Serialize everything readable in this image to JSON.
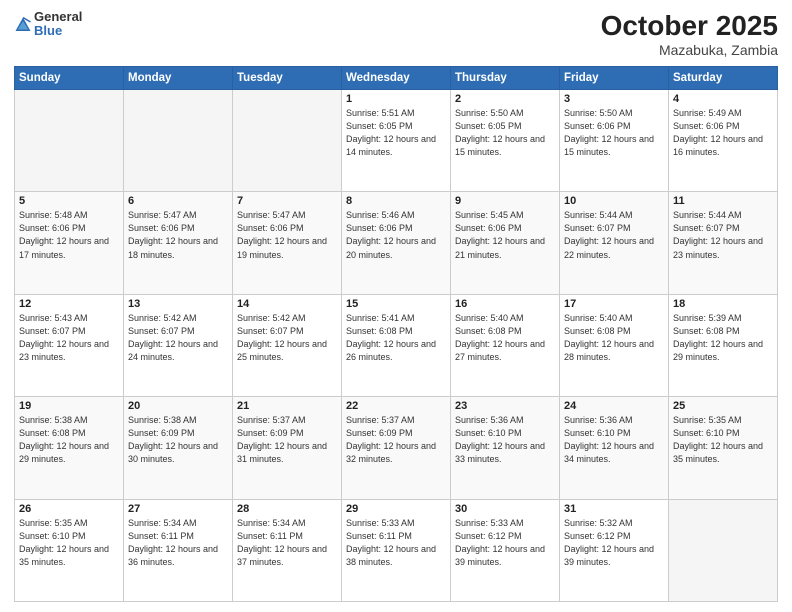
{
  "header": {
    "logo": {
      "general": "General",
      "blue": "Blue"
    },
    "title": "October 2025",
    "location": "Mazabuka, Zambia"
  },
  "calendar": {
    "days_of_week": [
      "Sunday",
      "Monday",
      "Tuesday",
      "Wednesday",
      "Thursday",
      "Friday",
      "Saturday"
    ],
    "weeks": [
      [
        {
          "day": "",
          "info": ""
        },
        {
          "day": "",
          "info": ""
        },
        {
          "day": "",
          "info": ""
        },
        {
          "day": "1",
          "info": "Sunrise: 5:51 AM\nSunset: 6:05 PM\nDaylight: 12 hours\nand 14 minutes."
        },
        {
          "day": "2",
          "info": "Sunrise: 5:50 AM\nSunset: 6:05 PM\nDaylight: 12 hours\nand 15 minutes."
        },
        {
          "day": "3",
          "info": "Sunrise: 5:50 AM\nSunset: 6:06 PM\nDaylight: 12 hours\nand 15 minutes."
        },
        {
          "day": "4",
          "info": "Sunrise: 5:49 AM\nSunset: 6:06 PM\nDaylight: 12 hours\nand 16 minutes."
        }
      ],
      [
        {
          "day": "5",
          "info": "Sunrise: 5:48 AM\nSunset: 6:06 PM\nDaylight: 12 hours\nand 17 minutes."
        },
        {
          "day": "6",
          "info": "Sunrise: 5:47 AM\nSunset: 6:06 PM\nDaylight: 12 hours\nand 18 minutes."
        },
        {
          "day": "7",
          "info": "Sunrise: 5:47 AM\nSunset: 6:06 PM\nDaylight: 12 hours\nand 19 minutes."
        },
        {
          "day": "8",
          "info": "Sunrise: 5:46 AM\nSunset: 6:06 PM\nDaylight: 12 hours\nand 20 minutes."
        },
        {
          "day": "9",
          "info": "Sunrise: 5:45 AM\nSunset: 6:06 PM\nDaylight: 12 hours\nand 21 minutes."
        },
        {
          "day": "10",
          "info": "Sunrise: 5:44 AM\nSunset: 6:07 PM\nDaylight: 12 hours\nand 22 minutes."
        },
        {
          "day": "11",
          "info": "Sunrise: 5:44 AM\nSunset: 6:07 PM\nDaylight: 12 hours\nand 23 minutes."
        }
      ],
      [
        {
          "day": "12",
          "info": "Sunrise: 5:43 AM\nSunset: 6:07 PM\nDaylight: 12 hours\nand 23 minutes."
        },
        {
          "day": "13",
          "info": "Sunrise: 5:42 AM\nSunset: 6:07 PM\nDaylight: 12 hours\nand 24 minutes."
        },
        {
          "day": "14",
          "info": "Sunrise: 5:42 AM\nSunset: 6:07 PM\nDaylight: 12 hours\nand 25 minutes."
        },
        {
          "day": "15",
          "info": "Sunrise: 5:41 AM\nSunset: 6:08 PM\nDaylight: 12 hours\nand 26 minutes."
        },
        {
          "day": "16",
          "info": "Sunrise: 5:40 AM\nSunset: 6:08 PM\nDaylight: 12 hours\nand 27 minutes."
        },
        {
          "day": "17",
          "info": "Sunrise: 5:40 AM\nSunset: 6:08 PM\nDaylight: 12 hours\nand 28 minutes."
        },
        {
          "day": "18",
          "info": "Sunrise: 5:39 AM\nSunset: 6:08 PM\nDaylight: 12 hours\nand 29 minutes."
        }
      ],
      [
        {
          "day": "19",
          "info": "Sunrise: 5:38 AM\nSunset: 6:08 PM\nDaylight: 12 hours\nand 29 minutes."
        },
        {
          "day": "20",
          "info": "Sunrise: 5:38 AM\nSunset: 6:09 PM\nDaylight: 12 hours\nand 30 minutes."
        },
        {
          "day": "21",
          "info": "Sunrise: 5:37 AM\nSunset: 6:09 PM\nDaylight: 12 hours\nand 31 minutes."
        },
        {
          "day": "22",
          "info": "Sunrise: 5:37 AM\nSunset: 6:09 PM\nDaylight: 12 hours\nand 32 minutes."
        },
        {
          "day": "23",
          "info": "Sunrise: 5:36 AM\nSunset: 6:10 PM\nDaylight: 12 hours\nand 33 minutes."
        },
        {
          "day": "24",
          "info": "Sunrise: 5:36 AM\nSunset: 6:10 PM\nDaylight: 12 hours\nand 34 minutes."
        },
        {
          "day": "25",
          "info": "Sunrise: 5:35 AM\nSunset: 6:10 PM\nDaylight: 12 hours\nand 35 minutes."
        }
      ],
      [
        {
          "day": "26",
          "info": "Sunrise: 5:35 AM\nSunset: 6:10 PM\nDaylight: 12 hours\nand 35 minutes."
        },
        {
          "day": "27",
          "info": "Sunrise: 5:34 AM\nSunset: 6:11 PM\nDaylight: 12 hours\nand 36 minutes."
        },
        {
          "day": "28",
          "info": "Sunrise: 5:34 AM\nSunset: 6:11 PM\nDaylight: 12 hours\nand 37 minutes."
        },
        {
          "day": "29",
          "info": "Sunrise: 5:33 AM\nSunset: 6:11 PM\nDaylight: 12 hours\nand 38 minutes."
        },
        {
          "day": "30",
          "info": "Sunrise: 5:33 AM\nSunset: 6:12 PM\nDaylight: 12 hours\nand 39 minutes."
        },
        {
          "day": "31",
          "info": "Sunrise: 5:32 AM\nSunset: 6:12 PM\nDaylight: 12 hours\nand 39 minutes."
        },
        {
          "day": "",
          "info": ""
        }
      ]
    ]
  }
}
